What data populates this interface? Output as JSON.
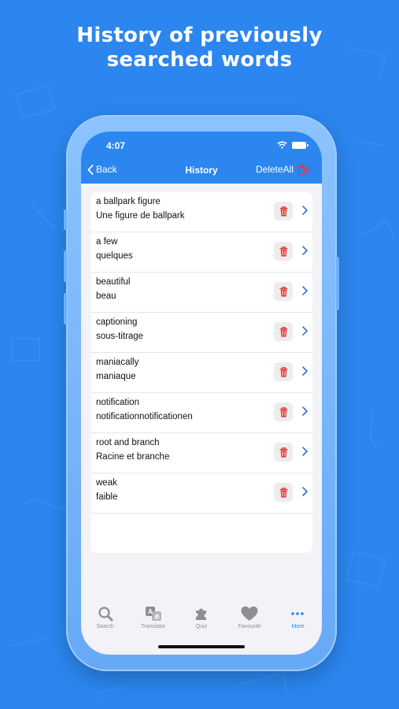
{
  "headline": {
    "line1": "History of previously",
    "line2": "searched words"
  },
  "status_bar": {
    "time": "4:07"
  },
  "nav": {
    "back_label": "Back",
    "title": "History",
    "delete_all_label": "DeleteAll"
  },
  "history": [
    {
      "word": "a ballpark figure",
      "translation": "Une figure de ballpark"
    },
    {
      "word": "a few",
      "translation": "quelques"
    },
    {
      "word": "beautiful",
      "translation": "beau"
    },
    {
      "word": "captioning",
      "translation": "sous-titrage"
    },
    {
      "word": "maniacally",
      "translation": "maniaque"
    },
    {
      "word": "notification",
      "translation": "notificationnotificationen"
    },
    {
      "word": "root and branch",
      "translation": "Racine et branche"
    },
    {
      "word": "weak",
      "translation": "faible"
    }
  ],
  "tabs": [
    {
      "label": "Search",
      "icon": "search-icon"
    },
    {
      "label": "Translator",
      "icon": "translator-icon"
    },
    {
      "label": "Quiz",
      "icon": "puzzle-icon"
    },
    {
      "label": "Favourite",
      "icon": "heart-icon"
    },
    {
      "label": "More",
      "icon": "more-icon",
      "active": true
    }
  ],
  "colors": {
    "background": "#2b86ef",
    "accent": "#2b86ef",
    "delete_red": "#e53935",
    "tab_inactive": "#8e8e93"
  }
}
